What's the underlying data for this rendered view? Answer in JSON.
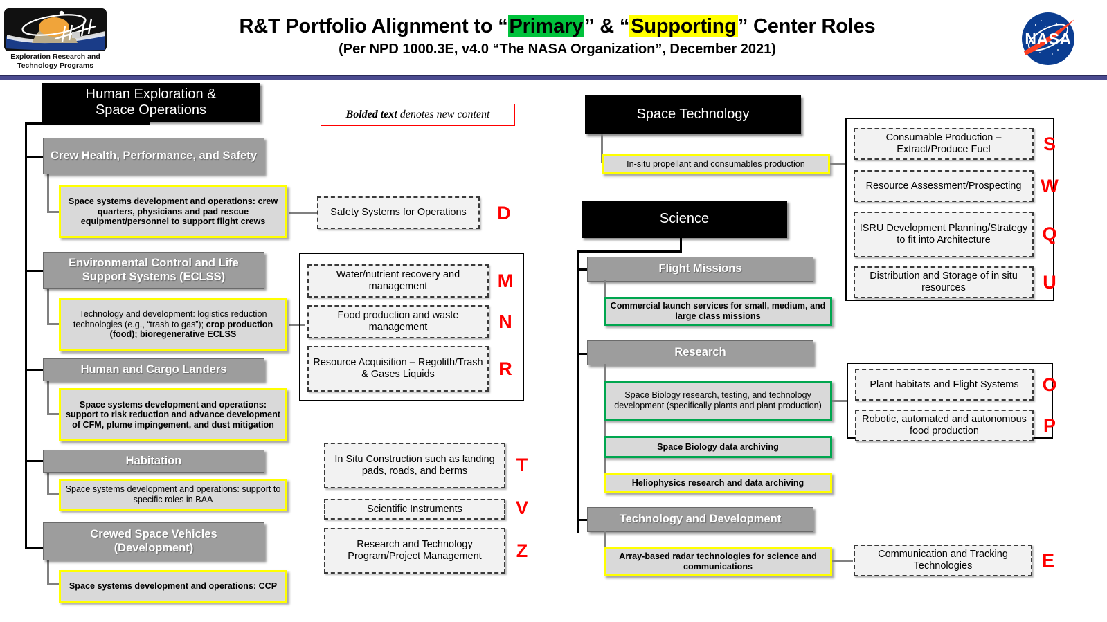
{
  "header": {
    "title_pre": "R&T Portfolio Alignment to “",
    "title_primary": "Primary",
    "title_mid": "” &  “",
    "title_supporting": "Supporting",
    "title_post": "” Center Roles",
    "subtitle": "(Per NPD 1000.3E, v4.0 “The NASA Organization”, December 2021)",
    "left_logo_caption_line1": "Exploration Research and",
    "left_logo_caption_line2": "Technology Programs",
    "right_logo_text": "NASA",
    "highlight_primary_color": "#00c23c",
    "highlight_supporting_color": "#ffff00",
    "rule_color": "#4a4a8f"
  },
  "legend": {
    "bold_part": "Bolded text",
    "rest_part": " denotes new content",
    "border_color": "#ff0000"
  },
  "columns": {
    "heso": {
      "title_line1": "Human Exploration &",
      "title_line2": "Space Operations",
      "groups": [
        {
          "header": "Crew Health, Performance, and Safety",
          "leaf": "Space systems development and operations: crew quarters, physicians and pad rescue equipment/personnel to support flight crews",
          "leaf_style": "yellow",
          "leaf_bold": true
        },
        {
          "header": "Environmental Control and Life Support Systems (ECLSS)",
          "leaf_plain_1": "Technology and development: logistics reduction technologies (e.g., “trash to gas”); ",
          "leaf_bold_1": "crop production (food); bioregenerative ECLSS",
          "leaf_style": "yellow",
          "leaf_bold": false
        },
        {
          "header": "Human and Cargo Landers",
          "leaf": "Space systems development and operations: support to risk reduction and advance development of CFM, plume impingement, and dust mitigation",
          "leaf_style": "yellow",
          "leaf_bold": true
        },
        {
          "header": "Habitation",
          "leaf": "Space systems development and operations: support to specific roles in BAA",
          "leaf_style": "yellow",
          "leaf_bold": false
        },
        {
          "header": "Crewed Space Vehicles (Development)",
          "leaf": "Space systems development and operations: CCP",
          "leaf_style": "yellow",
          "leaf_bold": true
        }
      ]
    },
    "space_technology": {
      "title": "Space Technology",
      "leaf": "In-situ propellant and consumables production",
      "leaf_style": "yellow"
    },
    "science": {
      "title": "Science",
      "groups": [
        {
          "header": "Flight Missions",
          "leaves": [
            {
              "text": "Commercial launch services for small, medium, and large class missions",
              "style": "green",
              "bold": true
            }
          ]
        },
        {
          "header": "Research",
          "leaves": [
            {
              "text": "Space Biology research, testing, and technology development (specifically plants and plant production)",
              "style": "green",
              "bold": false
            },
            {
              "text": "Space Biology data archiving",
              "style": "green",
              "bold": true
            },
            {
              "text": "Heliophysics research and data archiving",
              "style": "yellow",
              "bold": true
            }
          ]
        },
        {
          "header": "Technology and Development",
          "leaves": [
            {
              "text": "Array-based radar technologies for science and communications",
              "style": "yellow",
              "bold": true
            }
          ]
        }
      ]
    }
  },
  "role_boxes": {
    "safety_ops": {
      "text": "Safety Systems for Operations",
      "letter": "D"
    },
    "eclss_group": [
      {
        "text": "Water/nutrient recovery and management",
        "letter": "M"
      },
      {
        "text": "Food production and waste management",
        "letter": "N"
      },
      {
        "text": "Resource Acquisition – Regolith/Trash & Gases Liquids",
        "letter": "R"
      }
    ],
    "standalone_group": [
      {
        "text": "In Situ Construction such as landing pads, roads, and berms",
        "letter": "T"
      },
      {
        "text": "Scientific Instruments",
        "letter": "V"
      },
      {
        "text": "Research and Technology Program/Project Management",
        "letter": "Z"
      }
    ],
    "isru_group": [
      {
        "text": "Consumable Production – Extract/Produce Fuel",
        "letter": "S"
      },
      {
        "text": "Resource Assessment/Prospecting",
        "letter": "W"
      },
      {
        "text": "ISRU Development Planning/Strategy to fit into Architecture",
        "letter": "Q"
      },
      {
        "text": "Distribution and Storage of in situ resources",
        "letter": "U"
      }
    ],
    "research_group": [
      {
        "text": "Plant habitats and Flight Systems",
        "letter": "O"
      },
      {
        "text": "Robotic, automated and autonomous food production",
        "letter": "P"
      }
    ],
    "comm_track": {
      "text": "Communication and Tracking Technologies",
      "letter": "E"
    }
  },
  "colors": {
    "letter_red": "#ff0000",
    "yellow_border": "#ffff00",
    "green_border": "#00a64f",
    "gray_box": "#9d9d9d",
    "leaf_fill": "#d9d9d9",
    "dash_fill": "#f2f2f2"
  }
}
